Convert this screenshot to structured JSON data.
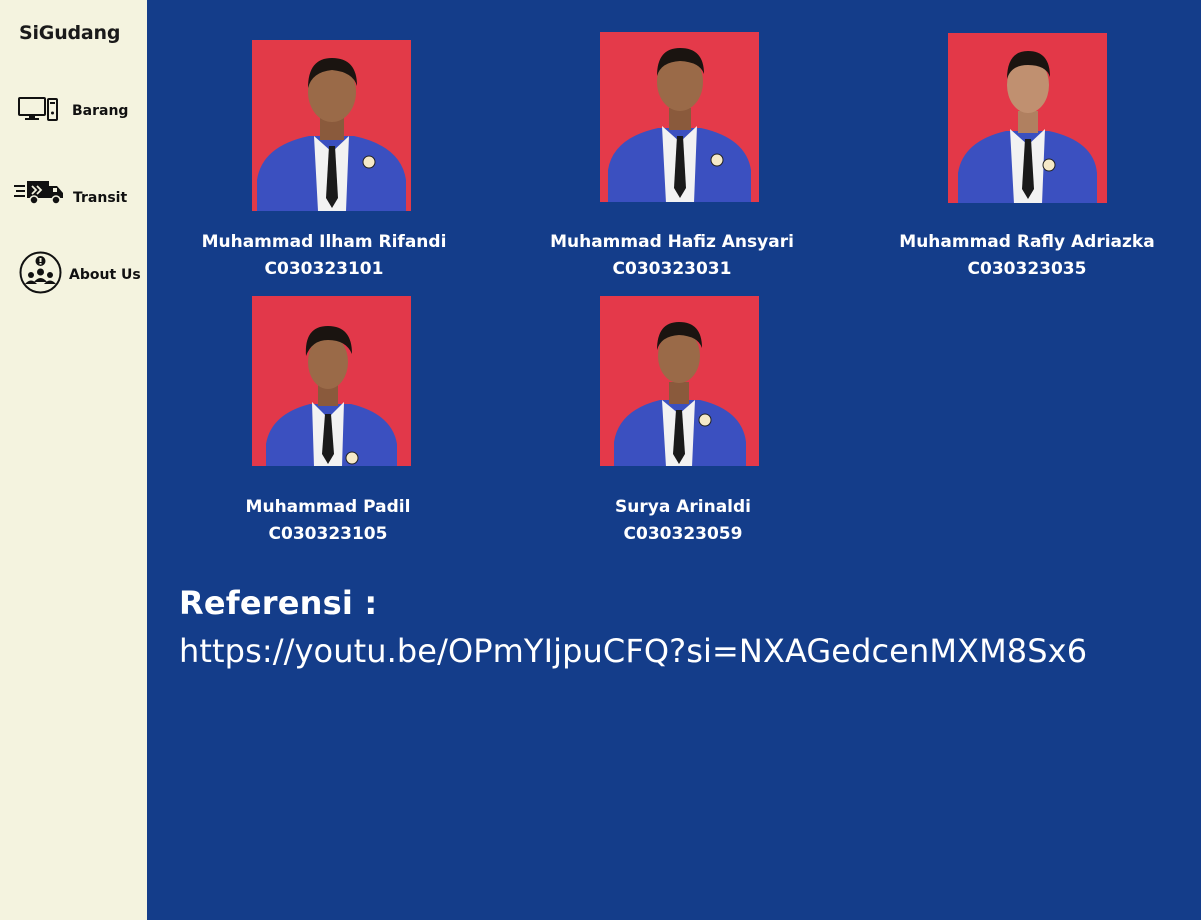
{
  "sidebar": {
    "brand": "SiGudang",
    "items": [
      {
        "label": "Barang",
        "icon": "computer-icon"
      },
      {
        "label": "Transit",
        "icon": "delivery-truck-icon"
      },
      {
        "label": "About Us",
        "icon": "team-info-icon"
      }
    ]
  },
  "members": [
    {
      "name": "Muhammad Ilham Rifandi",
      "id": "C030323101"
    },
    {
      "name": "Muhammad Hafiz Ansyari",
      "id": "C030323031"
    },
    {
      "name": "Muhammad Rafly Adriazka",
      "id": "C030323035"
    },
    {
      "name": "Muhammad Padil",
      "id": "C030323105"
    },
    {
      "name": "Surya Arinaldi",
      "id": "C030323059"
    }
  ],
  "reference": {
    "title": "Referensi :",
    "link": "https://youtu.be/OPmYIjpuCFQ?si=NXAGedcenMXM8Sx6"
  },
  "colors": {
    "sidebar_bg": "#f4f3df",
    "main_bg": "#143d8a",
    "photo_bg": "#e8374a",
    "jacket": "#3d54c4"
  }
}
